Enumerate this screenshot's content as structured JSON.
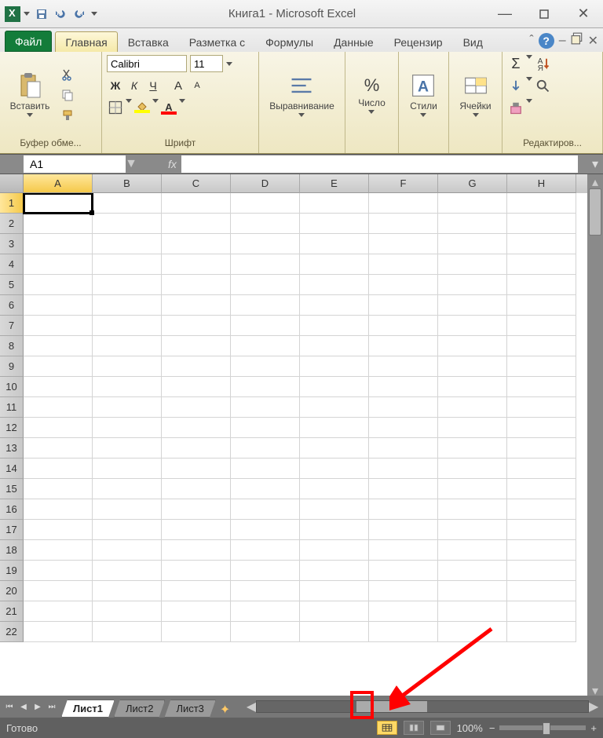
{
  "window": {
    "title": "Книга1  -  Microsoft Excel"
  },
  "tabs": {
    "file": "Файл",
    "items": [
      "Главная",
      "Вставка",
      "Разметка с",
      "Формулы",
      "Данные",
      "Рецензир",
      "Вид"
    ],
    "active": 0
  },
  "ribbon": {
    "clipboard": {
      "paste": "Вставить",
      "label": "Буфер обме..."
    },
    "font": {
      "name": "Calibri",
      "size": "11",
      "label": "Шрифт",
      "bold": "Ж",
      "italic": "К",
      "underline": "Ч"
    },
    "align": {
      "label": "Выравнивание"
    },
    "number": {
      "label": "Число"
    },
    "styles": {
      "label": "Стили"
    },
    "cells": {
      "label": "Ячейки"
    },
    "editing": {
      "label": "Редактиров..."
    }
  },
  "formula": {
    "namebox": "A1",
    "fx": "fx"
  },
  "grid": {
    "cols": [
      "A",
      "B",
      "C",
      "D",
      "E",
      "F",
      "G",
      "H"
    ],
    "rows": 22,
    "active": "A1"
  },
  "sheets": {
    "items": [
      "Лист1",
      "Лист2",
      "Лист3"
    ],
    "active": 0
  },
  "status": {
    "ready": "Готово",
    "zoom": "100%"
  },
  "icons": {
    "percent": "%",
    "sigma": "Σ",
    "help": "?",
    "minus": "—",
    "close": "✕",
    "plus": "+",
    "minus2": "−",
    "sort": "R"
  }
}
